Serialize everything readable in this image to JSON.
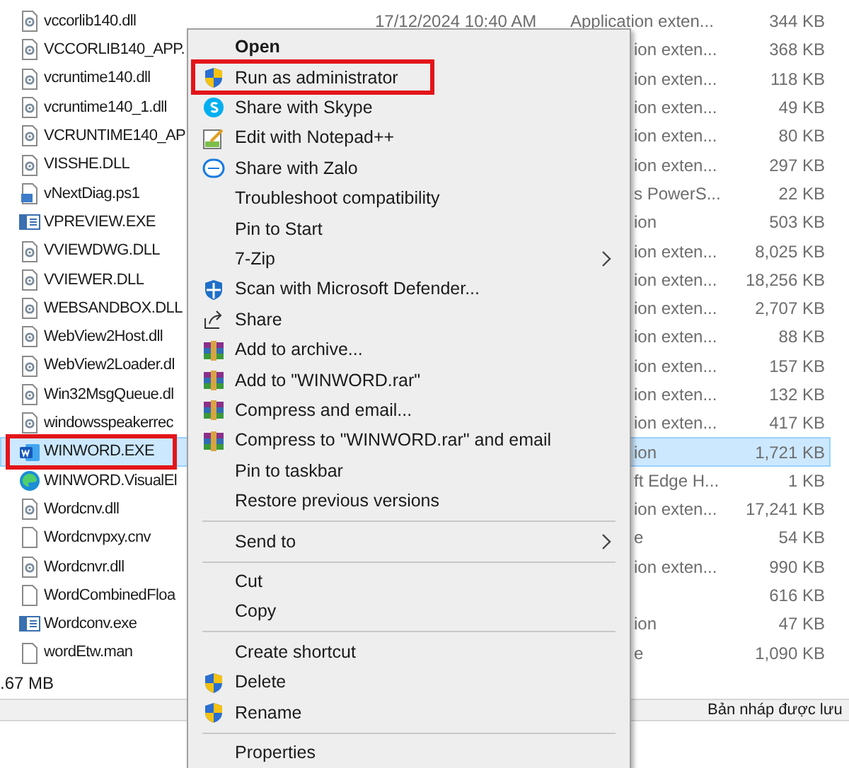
{
  "files": [
    {
      "name": "vccorlib140.dll",
      "kind": "dll",
      "date": "17/12/2024 10:40 AM",
      "type": "Application exten...",
      "size": "344 KB",
      "selected": false,
      "highlighted": false
    },
    {
      "name": "VCCORLIB140_APP.",
      "kind": "dll",
      "type": "ion exten...",
      "size": "368 KB",
      "selected": false,
      "highlighted": false
    },
    {
      "name": "vcruntime140.dll",
      "kind": "dll",
      "type": "ion exten...",
      "size": "118 KB",
      "selected": false,
      "highlighted": false
    },
    {
      "name": "vcruntime140_1.dll",
      "kind": "dll",
      "type": "ion exten...",
      "size": "49 KB",
      "selected": false,
      "highlighted": false
    },
    {
      "name": "VCRUNTIME140_AP",
      "kind": "dll",
      "type": "ion exten...",
      "size": "80 KB",
      "selected": false,
      "highlighted": false
    },
    {
      "name": "VISSHE.DLL",
      "kind": "dll",
      "type": "ion exten...",
      "size": "297 KB",
      "selected": false,
      "highlighted": false
    },
    {
      "name": "vNextDiag.ps1",
      "kind": "script",
      "type": "s PowerS...",
      "size": "22 KB",
      "selected": false,
      "highlighted": false
    },
    {
      "name": "VPREVIEW.EXE",
      "kind": "exe",
      "type": "ion",
      "size": "503 KB",
      "selected": false,
      "highlighted": false
    },
    {
      "name": "VVIEWDWG.DLL",
      "kind": "dll",
      "type": "ion exten...",
      "size": "8,025 KB",
      "selected": false,
      "highlighted": false
    },
    {
      "name": "VVIEWER.DLL",
      "kind": "dll",
      "type": "ion exten...",
      "size": "18,256 KB",
      "selected": false,
      "highlighted": false
    },
    {
      "name": "WEBSANDBOX.DLL",
      "kind": "dll",
      "type": "ion exten...",
      "size": "2,707 KB",
      "selected": false,
      "highlighted": false
    },
    {
      "name": "WebView2Host.dll",
      "kind": "dll",
      "type": "ion exten...",
      "size": "88 KB",
      "selected": false,
      "highlighted": false
    },
    {
      "name": "WebView2Loader.dl",
      "kind": "dll",
      "type": "ion exten...",
      "size": "157 KB",
      "selected": false,
      "highlighted": false
    },
    {
      "name": "Win32MsgQueue.dl",
      "kind": "dll",
      "type": "ion exten...",
      "size": "132 KB",
      "selected": false,
      "highlighted": false
    },
    {
      "name": "windowsspeakerrec",
      "kind": "dll",
      "type": "ion exten...",
      "size": "417 KB",
      "selected": false,
      "highlighted": false
    },
    {
      "name": "WINWORD.EXE",
      "kind": "word",
      "type": "ion",
      "size": "1,721 KB",
      "selected": true,
      "highlighted": true
    },
    {
      "name": "WINWORD.VisualEl",
      "kind": "edge",
      "type": "ft Edge H...",
      "size": "1 KB",
      "selected": false,
      "highlighted": false
    },
    {
      "name": "Wordcnv.dll",
      "kind": "dll",
      "type": "ion exten...",
      "size": "17,241 KB",
      "selected": false,
      "highlighted": false
    },
    {
      "name": "Wordcnvpxy.cnv",
      "kind": "blank",
      "type": "e",
      "size": "54 KB",
      "selected": false,
      "highlighted": false
    },
    {
      "name": "Wordcnvr.dll",
      "kind": "dll",
      "type": "ion exten...",
      "size": "990 KB",
      "selected": false,
      "highlighted": false
    },
    {
      "name": "WordCombinedFloa",
      "kind": "blank",
      "size": "616 KB",
      "selected": false,
      "highlighted": false
    },
    {
      "name": "Wordconv.exe",
      "kind": "exe",
      "type": "ion",
      "size": "47 KB",
      "selected": false,
      "highlighted": false
    },
    {
      "name": "wordEtw.man",
      "kind": "blank",
      "type": "e",
      "size": "1,090 KB",
      "selected": false,
      "highlighted": false
    }
  ],
  "status_bar": {
    "size": ".67 MB",
    "note": "Bản nháp được lưu"
  },
  "context_menu": [
    {
      "kind": "item",
      "label": "Open",
      "default": true,
      "submenu": false,
      "highlighted": false
    },
    {
      "kind": "item",
      "label": "Run as administrator",
      "default": false,
      "submenu": false,
      "highlighted": true
    },
    {
      "kind": "item",
      "label": "Share with Skype",
      "default": false,
      "submenu": false,
      "highlighted": false
    },
    {
      "kind": "item",
      "label": "Edit with Notepad++",
      "default": false,
      "submenu": false,
      "highlighted": false
    },
    {
      "kind": "item",
      "label": "Share with Zalo",
      "default": false,
      "submenu": false,
      "highlighted": false
    },
    {
      "kind": "item",
      "label": "Troubleshoot compatibility",
      "default": false,
      "submenu": false,
      "highlighted": false
    },
    {
      "kind": "item",
      "label": "Pin to Start",
      "default": false,
      "submenu": false,
      "highlighted": false
    },
    {
      "kind": "item",
      "label": "7-Zip",
      "default": false,
      "submenu": true,
      "highlighted": false
    },
    {
      "kind": "item",
      "label": "Scan with Microsoft Defender...",
      "default": false,
      "submenu": false,
      "highlighted": false
    },
    {
      "kind": "item",
      "label": "Share",
      "default": false,
      "submenu": false,
      "highlighted": false
    },
    {
      "kind": "item",
      "label": "Add to archive...",
      "default": false,
      "submenu": false,
      "highlighted": false
    },
    {
      "kind": "item",
      "label": "Add to \"WINWORD.rar\"",
      "default": false,
      "submenu": false,
      "highlighted": false
    },
    {
      "kind": "item",
      "label": "Compress and email...",
      "default": false,
      "submenu": false,
      "highlighted": false
    },
    {
      "kind": "item",
      "label": "Compress to \"WINWORD.rar\" and email",
      "default": false,
      "submenu": false,
      "highlighted": false
    },
    {
      "kind": "item",
      "label": "Pin to taskbar",
      "default": false,
      "submenu": false,
      "highlighted": false
    },
    {
      "kind": "item",
      "label": "Restore previous versions",
      "default": false,
      "submenu": false,
      "highlighted": false
    },
    {
      "kind": "separator"
    },
    {
      "kind": "item",
      "label": "Send to",
      "default": false,
      "submenu": true,
      "highlighted": false
    },
    {
      "kind": "separator"
    },
    {
      "kind": "item",
      "label": "Cut",
      "default": false,
      "submenu": false,
      "highlighted": false
    },
    {
      "kind": "item",
      "label": "Copy",
      "default": false,
      "submenu": false,
      "highlighted": false
    },
    {
      "kind": "separator"
    },
    {
      "kind": "item",
      "label": "Create shortcut",
      "default": false,
      "submenu": false,
      "highlighted": false
    },
    {
      "kind": "item",
      "label": "Delete",
      "default": false,
      "submenu": false,
      "highlighted": false
    },
    {
      "kind": "item",
      "label": "Rename",
      "default": false,
      "submenu": false,
      "highlighted": false
    },
    {
      "kind": "separator"
    },
    {
      "kind": "item",
      "label": "Properties",
      "default": false,
      "submenu": false,
      "highlighted": false
    }
  ]
}
